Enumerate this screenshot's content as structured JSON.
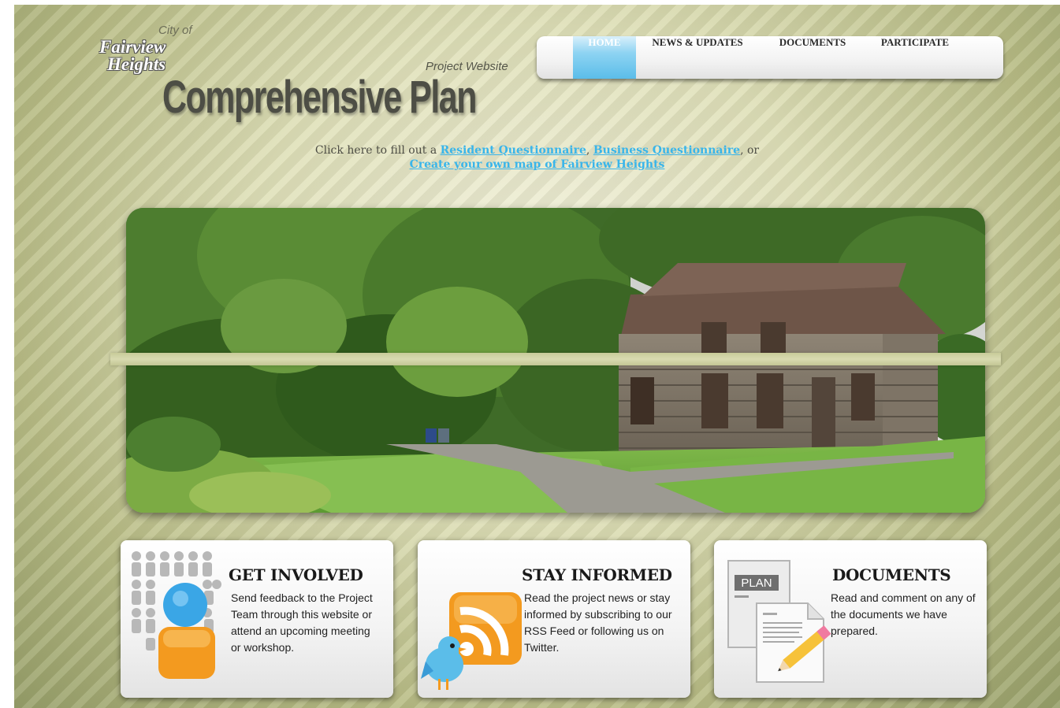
{
  "header": {
    "city_of": "City of",
    "city_line1": "Fairview",
    "city_line2": "Heights",
    "project_website": "Project Website",
    "title": "Comprehensive Plan"
  },
  "nav": {
    "items": [
      {
        "label": "HOME",
        "active": true
      },
      {
        "label": "NEWS & UPDATES",
        "active": false
      },
      {
        "label": "DOCUMENTS",
        "active": false
      },
      {
        "label": "PARTICIPATE",
        "active": false
      }
    ]
  },
  "cta": {
    "prefix": "Click here to fill out a ",
    "resident_link": "Resident Questionnaire",
    "sep": ", ",
    "business_link": "Business Questionnaire",
    "or": ", or",
    "map_link": "Create your own map of Fairview Heights"
  },
  "cards": [
    {
      "title": "GET INVOLVED",
      "text": "Send feedback to the Project Team through this website or attend an upcoming meeting or workshop.",
      "icon": "people-group-icon"
    },
    {
      "title": "STAY INFORMED",
      "text": "Read the project news or stay informed by subscribing to our RSS Feed or following us on Twitter.",
      "icon": "rss-twitter-icon"
    },
    {
      "title": "DOCUMENTS",
      "text": "Read and comment on any of the documents we have prepared.",
      "icon": "plan-documents-icon",
      "plan_label": "PLAN"
    }
  ],
  "colors": {
    "nav_active": "#5bbde9",
    "link": "#39b5ea",
    "background": "#dfe0b8",
    "rss_orange": "#f39a1f"
  }
}
